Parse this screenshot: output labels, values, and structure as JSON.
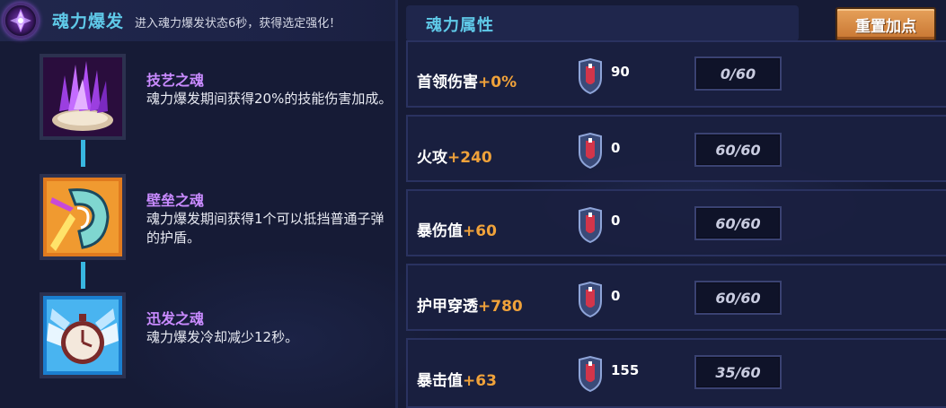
{
  "burst": {
    "title": "魂力爆发",
    "description": "进入魂力爆发状态6秒，获得选定强化！",
    "icon": "crystal-burst-icon"
  },
  "souls": [
    {
      "name": "技艺之魂",
      "name_color": "#c98bff",
      "description": "魂力爆发期间获得20%的技能伤害加成。",
      "icon": "purple-flame-icon"
    },
    {
      "name": "壁垒之魂",
      "name_color": "#c98bff",
      "description": "魂力爆发期间获得1个可以抵挡普通子弹的护盾。",
      "icon": "shield-fire-icon"
    },
    {
      "name": "迅发之魂",
      "name_color": "#c98bff",
      "description": "魂力爆发冷却减少12秒。",
      "icon": "stopwatch-wings-icon"
    }
  ],
  "attributes_panel": {
    "title": "魂力属性",
    "reset_label": "重置加点"
  },
  "attributes": [
    {
      "name": "首领伤害",
      "bonus": "+0%",
      "cost": "90",
      "progress": "0/60",
      "fill": 0.0
    },
    {
      "name": "火攻",
      "bonus": "+240",
      "cost": "0",
      "progress": "60/60",
      "fill": 1.0
    },
    {
      "name": "暴伤值",
      "bonus": "+60",
      "cost": "0",
      "progress": "60/60",
      "fill": 1.0
    },
    {
      "name": "护甲穿透",
      "bonus": "+780",
      "cost": "0",
      "progress": "60/60",
      "fill": 1.0
    },
    {
      "name": "暴击值",
      "bonus": "+63",
      "cost": "155",
      "progress": "35/60",
      "fill": 0.58
    }
  ],
  "colors": {
    "accent_cyan": "#5fc9e8",
    "bonus_orange": "#f0a23a",
    "reset_button": "#d88a45",
    "soul_name": "#c98bff"
  }
}
